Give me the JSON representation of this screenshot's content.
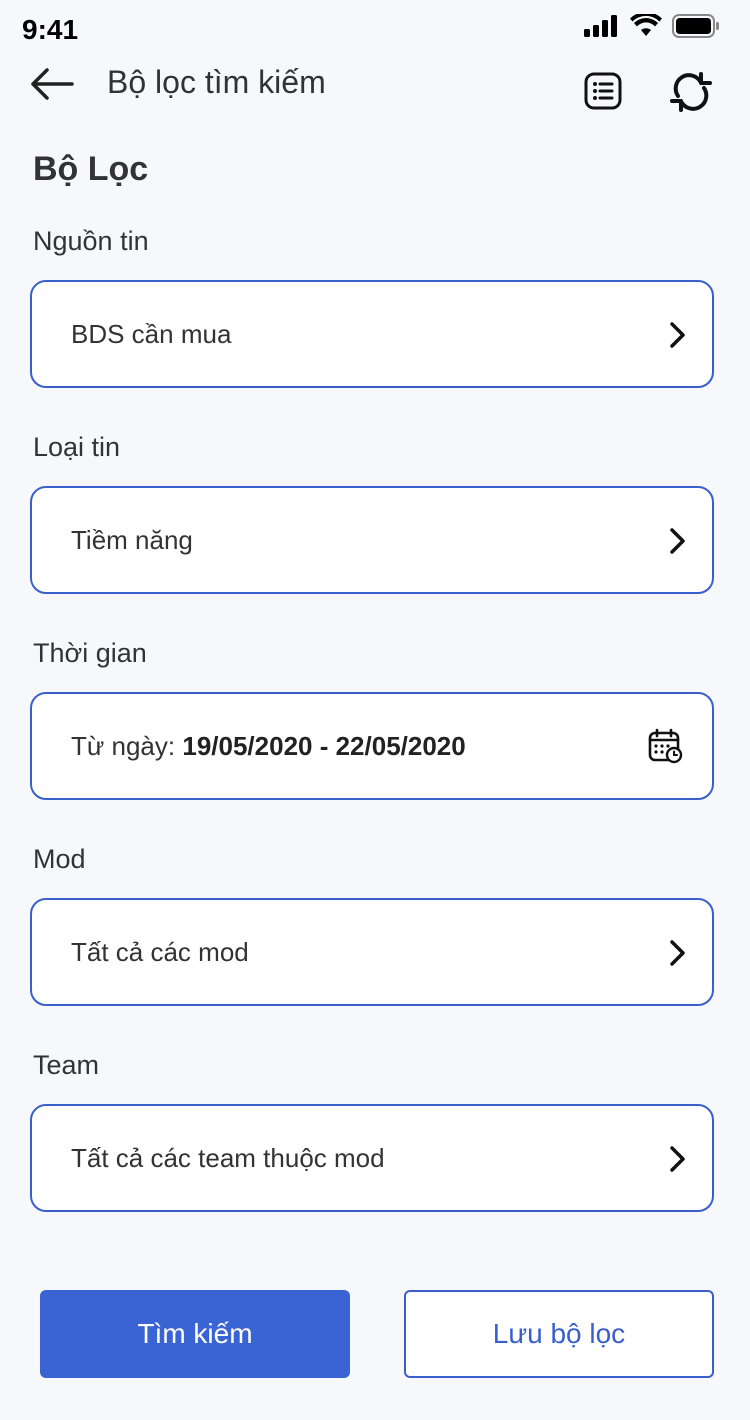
{
  "status_bar": {
    "time": "9:41"
  },
  "header": {
    "title": "Bộ lọc tìm kiếm"
  },
  "section_title": "Bộ Lọc",
  "fields": {
    "source": {
      "label": "Nguồn tin",
      "value": "BDS cần mua"
    },
    "type": {
      "label": "Loại tin",
      "value": "Tiềm năng"
    },
    "time": {
      "label": "Thời gian",
      "prefix": "Từ ngày:",
      "range": "19/05/2020 - 22/05/2020"
    },
    "mod": {
      "label": "Mod",
      "value": "Tất cả các mod"
    },
    "team": {
      "label": "Team",
      "value": "Tất cả các team thuộc mod"
    }
  },
  "actions": {
    "search": "Tìm kiếm",
    "save": "Lưu bộ lọc"
  },
  "colors": {
    "accent": "#3a63d3",
    "border": "#3a5fcd",
    "background": "#f6f8fc"
  }
}
